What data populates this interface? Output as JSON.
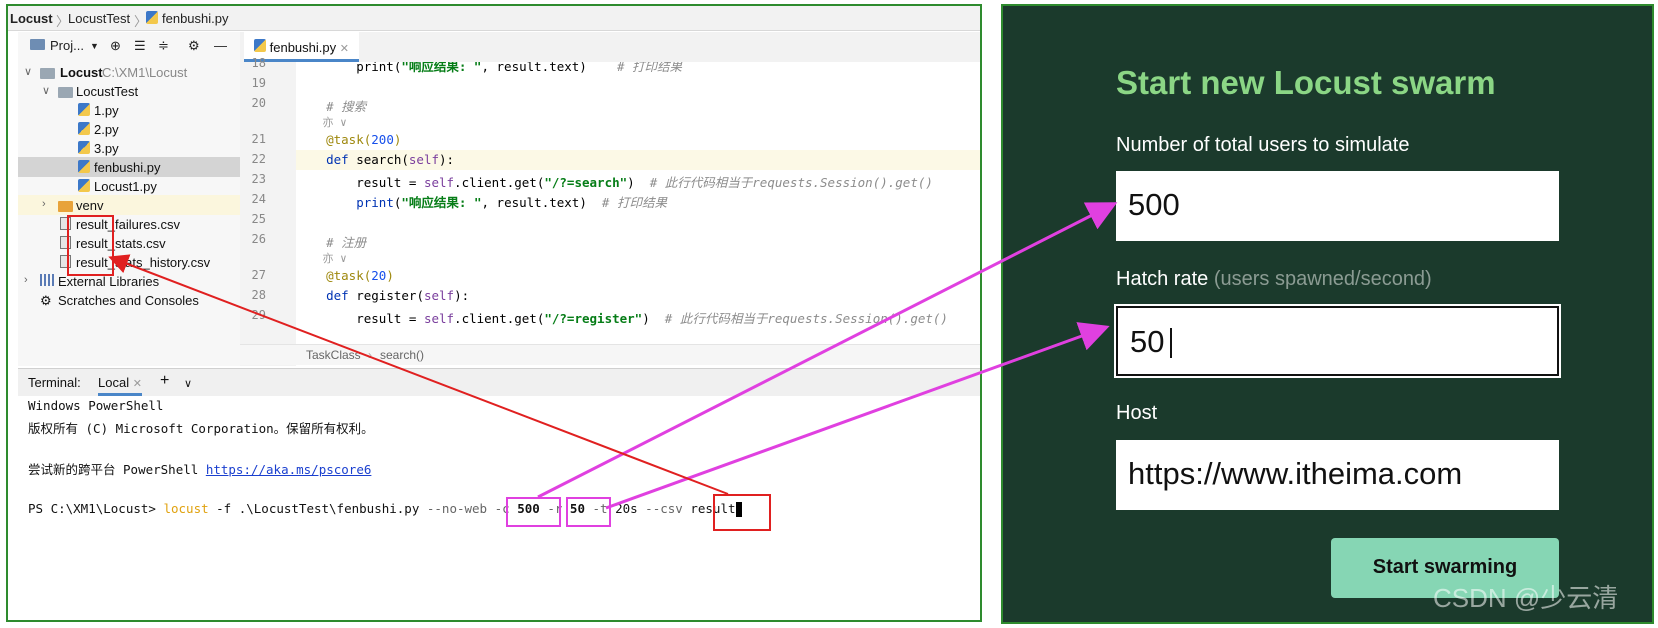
{
  "breadcrumb": [
    "Locust",
    "LocustTest",
    "fenbushi.py"
  ],
  "project_toolbar": {
    "label": "Proj...",
    "icons": [
      "project-icon",
      "locate-icon",
      "expand-icon",
      "collapse-icon",
      "gear-icon",
      "minimize-icon"
    ]
  },
  "tree": {
    "root": {
      "label": "Locust",
      "path": "C:\\XM1\\Locust"
    },
    "locusttest": "LocustTest",
    "files": [
      "1.py",
      "2.py",
      "3.py",
      "fenbushi.py",
      "Locust1.py"
    ],
    "venv": "venv",
    "csv_files": [
      "result_failures.csv",
      "result_stats.csv",
      "result_stats_history.csv"
    ],
    "external": "External Libraries",
    "scratches": "Scratches and Consoles"
  },
  "editor": {
    "tab": "fenbushi.py",
    "line_numbers": [
      "18",
      "19",
      "20",
      "21",
      "22",
      "23",
      "24",
      "25",
      "26",
      "27",
      "28",
      "29"
    ],
    "code": {
      "l18_a": "        print(",
      "l18_str": "\"响应结果: \"",
      "l18_b": ", result.text)    ",
      "l18_cm": "# 打印结果",
      "l20_cm": "    # 搜索",
      "hint": "亦",
      "l21_dec": "    @task(",
      "l21_num": "200",
      "l21_end": ")",
      "l22_kw": "    def ",
      "l22_fn": "search",
      "l22_b": "(",
      "l22_self": "self",
      "l22_c": "):",
      "l23_a": "        result = ",
      "l23_self": "self",
      "l23_b": ".client.get(",
      "l23_str": "\"/?=search\"",
      "l23_c": ")  ",
      "l23_cm": "# 此行代码相当于requests.Session().get()",
      "l24_a": "        ",
      "l24_fn": "print",
      "l24_b": "(",
      "l24_str": "\"响应结果: \"",
      "l24_c": ", result.text)  ",
      "l24_cm": "# 打印结果",
      "l26_cm": "    # 注册",
      "l27_dec": "    @task(",
      "l27_num": "20",
      "l27_end": ")",
      "l28_kw": "    def ",
      "l28_fn": "register",
      "l28_b": "(",
      "l28_self": "self",
      "l28_c": "):",
      "l29_a": "        result = ",
      "l29_self": "self",
      "l29_b": ".client.get(",
      "l29_str": "\"/?=register\"",
      "l29_c": ")  ",
      "l29_cm": "# 此行代码相当于requests.Session().get()"
    },
    "status_crumb": [
      "TaskClass",
      "search()"
    ]
  },
  "terminal": {
    "label": "Terminal:",
    "tab": "Local",
    "lines": {
      "l1": "Windows PowerShell",
      "l2": "版权所有 (C) Microsoft Corporation。保留所有权利。",
      "l3": "尝试新的跨平台 PowerShell ",
      "l3_link": "https://aka.ms/pscore6",
      "prompt": "PS C:\\XM1\\Locust> ",
      "cmd": "locust",
      "args1": " -f .\\LocustTest\\fenbushi.py ",
      "noweb": "--no-web",
      "sp1": " ",
      "flag_c": "-c",
      "val_c": " 500",
      "sp2": " ",
      "flag_r": "-r",
      "val_r": " 50",
      "flag_t": " -t",
      "val_t": " 20s",
      "flag_csv": " --csv",
      "sp3": " ",
      "val_csv": "result"
    }
  },
  "locust_form": {
    "title": "Start new Locust swarm",
    "users_label": "Number of total users to simulate",
    "users_value": "500",
    "hatch_label": "Hatch rate",
    "hatch_sub": "(users spawned/second)",
    "hatch_value": "50",
    "host_label": "Host",
    "host_value": "https://www.itheima.com",
    "button": "Start swarming"
  },
  "watermark": "CSDN @少云清",
  "colors": {
    "ide_border": "#2e8b2e",
    "locust_bg": "#1b3a2c",
    "title_green": "#8bd685",
    "button_bg": "#86d6b4",
    "red_annotation": "#e02020",
    "magenta_annotation": "#e040e0"
  }
}
